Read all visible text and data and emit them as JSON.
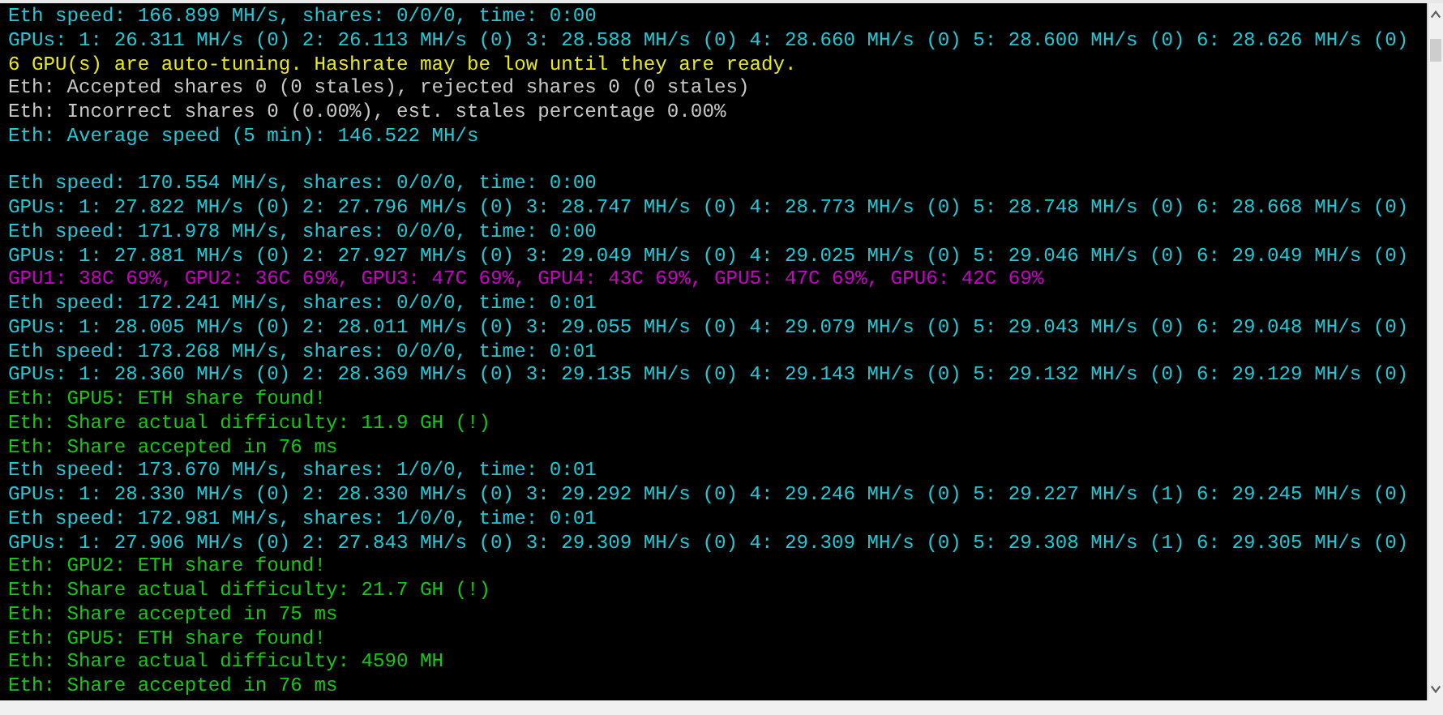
{
  "console": {
    "lines": [
      {
        "kind": "speed",
        "text": "Eth speed: 166.899 MH/s, shares: 0/0/0, time: 0:00"
      },
      {
        "kind": "speed",
        "text": "GPUs: 1: 26.311 MH/s (0) 2: 26.113 MH/s (0) 3: 28.588 MH/s (0) 4: 28.660 MH/s (0) 5: 28.600 MH/s (0) 6: 28.626 MH/s (0)"
      },
      {
        "kind": "warning",
        "text": "6 GPU(s) are auto-tuning. Hashrate may be low until they are ready."
      },
      {
        "kind": "info",
        "text": "Eth: Accepted shares 0 (0 stales), rejected shares 0 (0 stales)"
      },
      {
        "kind": "info",
        "text": "Eth: Incorrect shares 0 (0.00%), est. stales percentage 0.00%"
      },
      {
        "kind": "speed",
        "text": "Eth: Average speed (5 min): 146.522 MH/s"
      },
      {
        "kind": "blank"
      },
      {
        "kind": "speed",
        "text": "Eth speed: 170.554 MH/s, shares: 0/0/0, time: 0:00"
      },
      {
        "kind": "speed",
        "text": "GPUs: 1: 27.822 MH/s (0) 2: 27.796 MH/s (0) 3: 28.747 MH/s (0) 4: 28.773 MH/s (0) 5: 28.748 MH/s (0) 6: 28.668 MH/s (0)"
      },
      {
        "kind": "speed",
        "text": "Eth speed: 171.978 MH/s, shares: 0/0/0, time: 0:00"
      },
      {
        "kind": "speed",
        "text": "GPUs: 1: 27.881 MH/s (0) 2: 27.927 MH/s (0) 3: 29.049 MH/s (0) 4: 29.025 MH/s (0) 5: 29.046 MH/s (0) 6: 29.049 MH/s (0)"
      },
      {
        "kind": "temps",
        "text": "GPU1: 38C 69%, GPU2: 36C 69%, GPU3: 47C 69%, GPU4: 43C 69%, GPU5: 47C 69%, GPU6: 42C 69%"
      },
      {
        "kind": "speed",
        "text": "Eth speed: 172.241 MH/s, shares: 0/0/0, time: 0:01"
      },
      {
        "kind": "speed",
        "text": "GPUs: 1: 28.005 MH/s (0) 2: 28.011 MH/s (0) 3: 29.055 MH/s (0) 4: 29.079 MH/s (0) 5: 29.043 MH/s (0) 6: 29.048 MH/s (0)"
      },
      {
        "kind": "speed",
        "text": "Eth speed: 173.268 MH/s, shares: 0/0/0, time: 0:01"
      },
      {
        "kind": "speed",
        "text": "GPUs: 1: 28.360 MH/s (0) 2: 28.369 MH/s (0) 3: 29.135 MH/s (0) 4: 29.143 MH/s (0) 5: 29.132 MH/s (0) 6: 29.129 MH/s (0)"
      },
      {
        "kind": "share",
        "text": "Eth: GPU5: ETH share found!"
      },
      {
        "kind": "share",
        "text": "Eth: Share actual difficulty: 11.9 GH (!)"
      },
      {
        "kind": "share",
        "text": "Eth: Share accepted in 76 ms"
      },
      {
        "kind": "speed",
        "text": "Eth speed: 173.670 MH/s, shares: 1/0/0, time: 0:01"
      },
      {
        "kind": "speed",
        "text": "GPUs: 1: 28.330 MH/s (0) 2: 28.330 MH/s (0) 3: 29.292 MH/s (0) 4: 29.246 MH/s (0) 5: 29.227 MH/s (1) 6: 29.245 MH/s (0)"
      },
      {
        "kind": "speed",
        "text": "Eth speed: 172.981 MH/s, shares: 1/0/0, time: 0:01"
      },
      {
        "kind": "speed",
        "text": "GPUs: 1: 27.906 MH/s (0) 2: 27.843 MH/s (0) 3: 29.309 MH/s (0) 4: 29.309 MH/s (0) 5: 29.308 MH/s (1) 6: 29.305 MH/s (0)"
      },
      {
        "kind": "share",
        "text": "Eth: GPU2: ETH share found!"
      },
      {
        "kind": "share",
        "text": "Eth: Share actual difficulty: 21.7 GH (!)"
      },
      {
        "kind": "share",
        "text": "Eth: Share accepted in 75 ms"
      },
      {
        "kind": "share",
        "text": "Eth: GPU5: ETH share found!"
      },
      {
        "kind": "share",
        "text": "Eth: Share actual difficulty: 4590 MH"
      },
      {
        "kind": "share",
        "text": "Eth: Share accepted in 76 ms"
      }
    ]
  }
}
